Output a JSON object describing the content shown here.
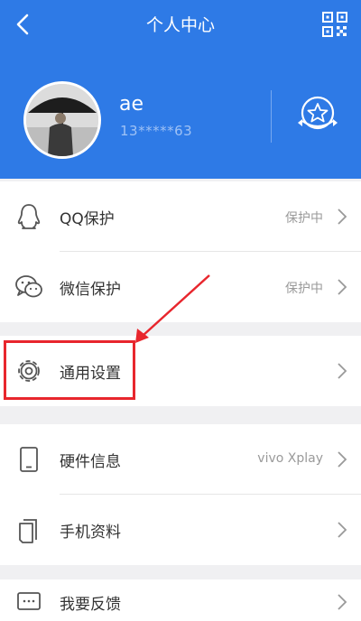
{
  "header": {
    "title": "个人中心",
    "back_icon": "chevron-left-icon",
    "qr_icon": "qr-code-icon",
    "background_color": "#2e7ae6"
  },
  "profile": {
    "username": "ae",
    "phone": "13*****63",
    "avatar": "avatar-photo-man-with-umbrella",
    "badge_icon": "star-ribbon-badge-icon"
  },
  "sections": [
    {
      "items": [
        {
          "label": "QQ保护",
          "value": "保护中",
          "icon": "qq-penguin-icon"
        },
        {
          "label": "微信保护",
          "value": "保护中",
          "icon": "wechat-icon"
        }
      ]
    },
    {
      "items": [
        {
          "label": "通用设置",
          "value": "",
          "icon": "gear-icon"
        }
      ]
    },
    {
      "items": [
        {
          "label": "硬件信息",
          "value": "vivo Xplay",
          "icon": "phone-device-icon"
        },
        {
          "label": "手机资料",
          "value": "",
          "icon": "documents-icon"
        }
      ]
    },
    {
      "items": [
        {
          "label": "我要反馈",
          "value": "",
          "icon": "feedback-chat-icon"
        }
      ]
    }
  ],
  "annotation": {
    "color": "#e8262d"
  }
}
